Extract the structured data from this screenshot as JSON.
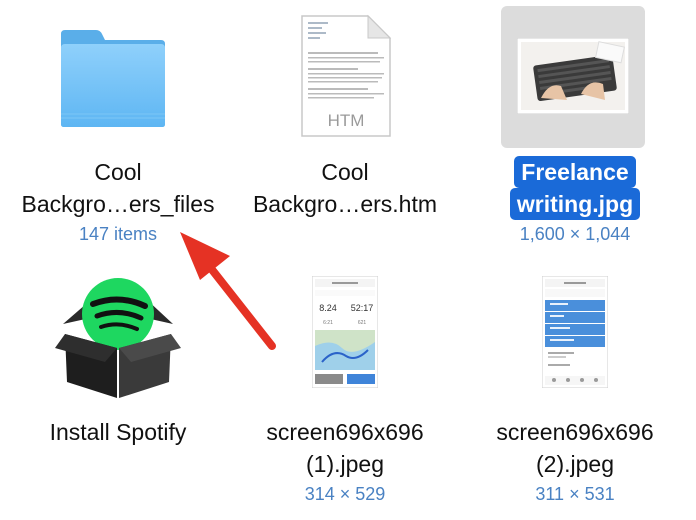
{
  "items": [
    {
      "line1": "Cool",
      "line2": "Backgro…ers_files",
      "meta": "147 items",
      "icon": "folder-icon"
    },
    {
      "line1": "Cool",
      "line2": "Backgro…ers.htm",
      "meta": "",
      "icon": "html-document-icon",
      "badge": "HTM"
    },
    {
      "line1": "Freelance",
      "line2": "writing.jpg",
      "meta": "1,600 × 1,044",
      "icon": "image-thumbnail",
      "selected": true
    },
    {
      "line1": "Install Spotify",
      "line2": "",
      "meta": "",
      "icon": "spotify-installer-icon"
    },
    {
      "line1": "screen696x696",
      "line2": "(1).jpeg",
      "meta": "314 × 529",
      "icon": "phone-screenshot-thumbnail",
      "app": {
        "dist": "8.24",
        "time": "52:17",
        "pace": "6:21",
        "cal": "621"
      }
    },
    {
      "line1": "screen696x696",
      "line2": "(2).jpeg",
      "meta": "311 × 531",
      "icon": "phone-screenshot-thumbnail"
    }
  ],
  "colors": {
    "selection": "#1a6ad8",
    "meta_text": "#4a82c3",
    "arrow": "#e53224",
    "folder": "#6cbdf5"
  }
}
